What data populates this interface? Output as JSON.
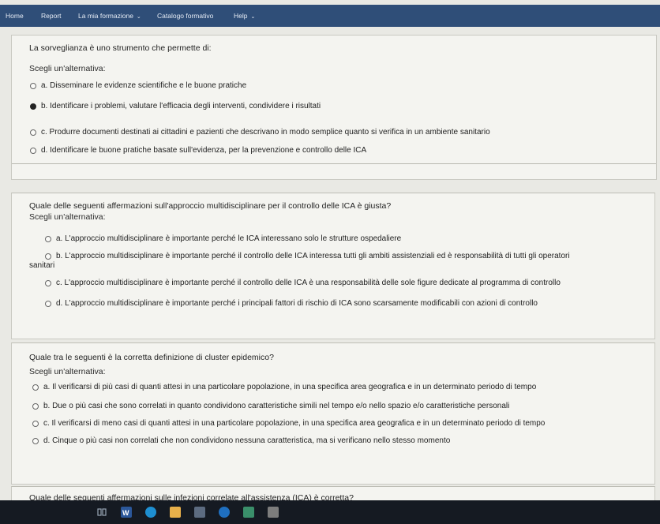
{
  "nav": {
    "home": "Home",
    "report": "Report",
    "training": "La mia formazione",
    "catalog": "Catalogo formativo",
    "help": "Help"
  },
  "q1": {
    "text": "La sorveglianza è uno strumento che permette di:",
    "prompt": "Scegli un'alternativa:",
    "options": [
      "a. Disseminare le evidenze scientifiche e le buone pratiche",
      "b. Identificare i problemi, valutare l'efficacia degli interventi, condividere i risultati",
      "c. Produrre documenti destinati ai cittadini e pazienti che descrivano in modo semplice quanto si verifica in un ambiente sanitario",
      "d. Identificare le buone pratiche basate sull'evidenza, per la prevenzione e controllo delle ICA"
    ],
    "selected": 1
  },
  "q2": {
    "text": "Quale delle seguenti affermazioni sull'approccio multidisciplinare per il controllo delle ICA è giusta?",
    "prompt": "Scegli un'alternativa:",
    "options": [
      "a. L'approccio multidisciplinare è importante perché le ICA interessano solo le strutture ospedaliere",
      "b. L'approccio multidisciplinare è importante perché il controllo delle ICA interessa tutti gli ambiti assistenziali ed è responsabilità di tutti gli operatori",
      "sanitari",
      "c. L'approccio multidisciplinare è importante perché il controllo delle ICA è una responsabilità delle sole figure dedicate al programma di controllo",
      "d. L'approccio multidisciplinare è importante perché i principali fattori di rischio di ICA sono scarsamente modificabili con azioni di controllo"
    ]
  },
  "q3": {
    "text": "Quale tra le seguenti è la corretta definizione di cluster epidemico?",
    "prompt": "Scegli un'alternativa:",
    "options": [
      "a. Il verificarsi di più casi di quanti attesi in una particolare popolazione, in una specifica area geografica e in un determinato periodo di tempo",
      "b. Due o più casi che sono correlati in quanto condividono caratteristiche simili nel tempo e/o nello spazio e/o caratteristiche personali",
      "c. Il verificarsi di meno casi di quanti attesi in una particolare popolazione, in una specifica area geografica e in un determinato periodo di tempo",
      "d. Cinque o più casi non correlati che non condividono nessuna caratteristica, ma si verificano nello stesso momento"
    ]
  },
  "q4": {
    "text": "Quale delle seguenti affermazioni sulle infezioni correlate all'assistenza (ICA) è corretta?"
  },
  "taskbar": {
    "icons": [
      "taskview-icon",
      "word-icon",
      "edge-icon",
      "explorer-icon",
      "store-icon",
      "outlook-icon",
      "photos-icon",
      "app-icon"
    ],
    "colors": [
      "#9aa6b5",
      "#2b579a",
      "#1e8fd1",
      "#e8b04a",
      "#5c6b80",
      "#1f6fbf",
      "#3a8f6a",
      "#7d7d7d"
    ]
  }
}
